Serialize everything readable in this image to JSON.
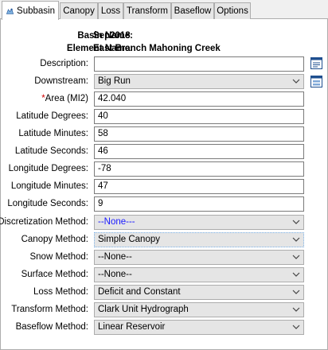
{
  "tabs": [
    {
      "label": "Subbasin",
      "active": true
    },
    {
      "label": "Canopy"
    },
    {
      "label": "Loss"
    },
    {
      "label": "Transform"
    },
    {
      "label": "Baseflow"
    },
    {
      "label": "Options"
    }
  ],
  "header": {
    "basin_label": "Basin Name:",
    "basin_value": "Sep2018",
    "element_label": "Element Name:",
    "element_value": "East Branch Mahoning Creek"
  },
  "fields": {
    "description": {
      "label": "Description:",
      "value": ""
    },
    "downstream": {
      "label": "Downstream:",
      "value": "Big Run"
    },
    "area": {
      "required_mark": "*",
      "label": "Area (MI2)",
      "value": "42.040"
    },
    "lat_deg": {
      "label": "Latitude Degrees:",
      "value": "40"
    },
    "lat_min": {
      "label": "Latitude Minutes:",
      "value": "58"
    },
    "lat_sec": {
      "label": "Latitude Seconds:",
      "value": "46"
    },
    "lon_deg": {
      "label": "Longitude Degrees:",
      "value": "-78"
    },
    "lon_min": {
      "label": "Longitude Minutes:",
      "value": "47"
    },
    "lon_sec": {
      "label": "Longitude Seconds:",
      "value": "9"
    },
    "discretization": {
      "label": "Discretization Method:",
      "value": "--None---"
    },
    "canopy": {
      "label": "Canopy Method:",
      "value": "Simple Canopy"
    },
    "snow": {
      "label": "Snow Method:",
      "value": "--None--"
    },
    "surface": {
      "label": "Surface Method:",
      "value": "--None--"
    },
    "loss": {
      "label": "Loss Method:",
      "value": "Deficit and Constant"
    },
    "transform": {
      "label": "Transform Method:",
      "value": "Clark Unit Hydrograph"
    },
    "baseflow": {
      "label": "Baseflow Method:",
      "value": "Linear Reservoir"
    }
  },
  "icons": {
    "subbasin_tab": "subbasin-icon",
    "description_editor": "description-editor-icon",
    "downstream_select": "element-select-icon"
  },
  "colors": {
    "required": "#d00000",
    "none_option": "#1a1aff"
  }
}
